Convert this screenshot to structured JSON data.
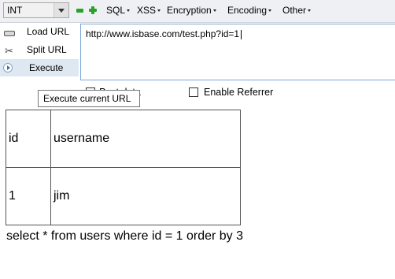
{
  "toolbar": {
    "type_select": "INT",
    "menus": [
      "SQL",
      "XSS",
      "Encryption",
      "Encoding",
      "Other"
    ]
  },
  "actions": {
    "load_url": "Load URL",
    "split_url": "Split URL",
    "execute": "Execute"
  },
  "url": {
    "value": "http://www.isbase.com/test.php?id=1"
  },
  "options": {
    "post_data": "Post data",
    "enable_referrer": "Enable Referrer"
  },
  "tooltip": {
    "text": "Execute current URL"
  },
  "results": {
    "headers": [
      "id",
      "username"
    ],
    "rows": [
      [
        "1",
        "jim"
      ]
    ]
  },
  "query_text": "select * from users where id = 1 order by 3"
}
